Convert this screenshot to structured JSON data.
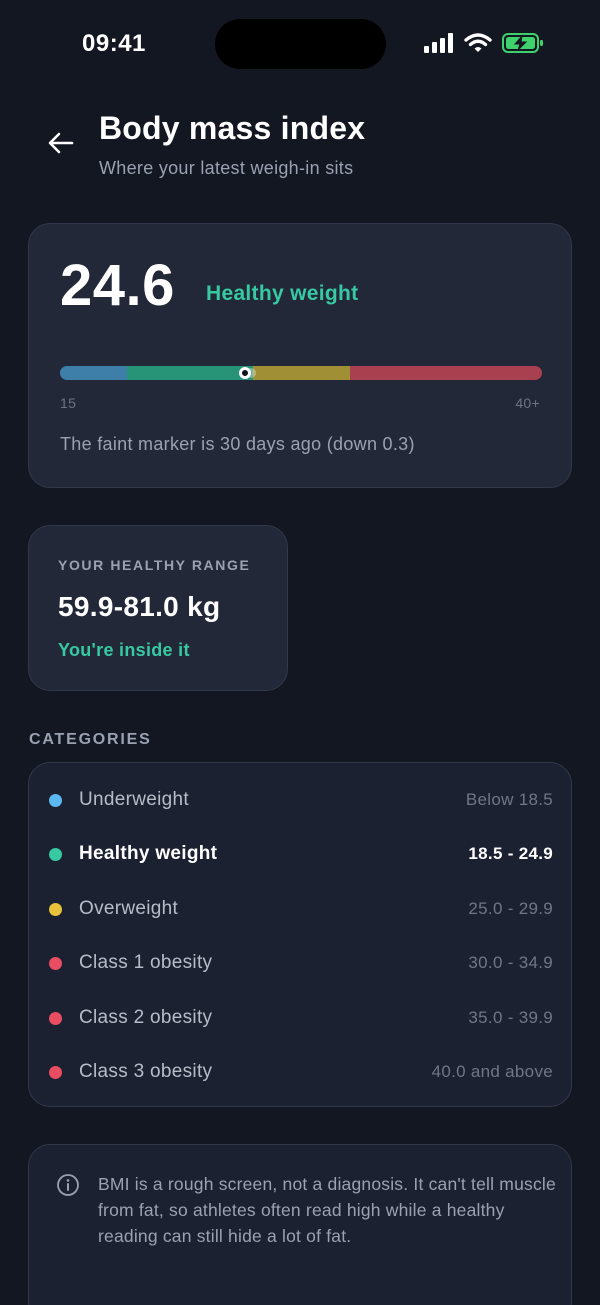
{
  "status_bar": {
    "time": "09:41"
  },
  "header": {
    "title": "Body mass index",
    "subtitle": "Where your latest weigh-in sits"
  },
  "bmi_card": {
    "value": "24.6",
    "category": "Healthy weight",
    "scale_min": "15",
    "scale_max": "40+",
    "current_bmi": 24.6,
    "previous_bmi": 24.9,
    "note": "The faint marker is 30 days ago (down 0.3)",
    "colors": {
      "underweight": "#3d7fa8",
      "healthy": "#279478",
      "overweight": "#a18f36",
      "obese": "#a8404f"
    }
  },
  "range_card": {
    "label": "YOUR HEALTHY RANGE",
    "value": "59.9-81.0 kg",
    "status": "You're inside it"
  },
  "categories": {
    "heading": "CATEGORIES",
    "items": [
      {
        "name": "Underweight",
        "range": "Below 18.5",
        "color": "#5cb8f0",
        "active": false
      },
      {
        "name": "Healthy weight",
        "range": "18.5 - 24.9",
        "color": "#36c9a2",
        "active": true
      },
      {
        "name": "Overweight",
        "range": "25.0 - 29.9",
        "color": "#e8c23a",
        "active": false
      },
      {
        "name": "Class 1 obesity",
        "range": "30.0 - 34.9",
        "color": "#e94d62",
        "active": false
      },
      {
        "name": "Class 2 obesity",
        "range": "35.0 - 39.9",
        "color": "#e94d62",
        "active": false
      },
      {
        "name": "Class 3 obesity",
        "range": "40.0 and above",
        "color": "#e94d62",
        "active": false
      }
    ]
  },
  "info": {
    "text": "BMI is a rough screen, not a diagnosis. It can't tell muscle from fat, so athletes often read high while a healthy reading can still hide a lot of fat."
  }
}
